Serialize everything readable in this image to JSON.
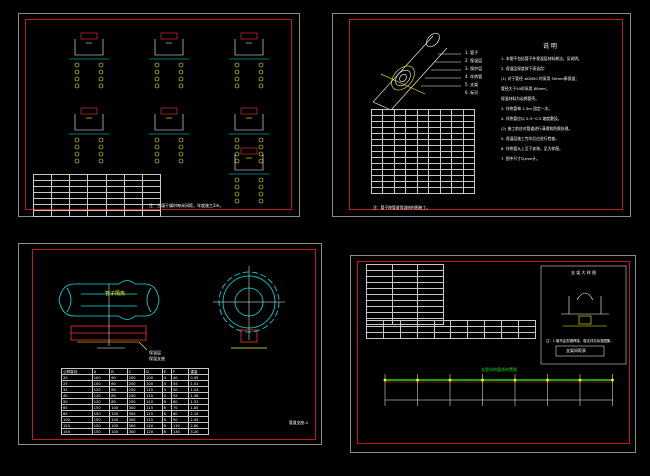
{
  "sheet1": {
    "footnote": "注：土壤干燥时每米间距，年度施工2m。",
    "table_rows": 7
  },
  "sheet2": {
    "legend_items": [
      "1. 管子",
      "2. 保温层",
      "3. 保护层",
      "4. 伴热管",
      "5. 支架",
      "6. 标识"
    ],
    "notes_title": "说 明",
    "notes": [
      "1. 本图不包括管子外保温层材料做法，见说明。",
      "2. 保温层厚度按下表选用：",
      "(1) 对于管径 ≤DN50 时采用 50mm厚保温；",
      "   管径大于50时采用 80mm；",
      "   保温材料为岩棉管壳。",
      "3. 伴热管每 1.5m 固定一次。",
      "4. 伴热管应以 0.3~0.5 坡度敷设。",
      "(2) 施工前应对管道进行清理和防腐处理。",
      "5. 保温层施工完毕后应进行检查。",
      "6. 伴热管从上至下安装，见大样图。",
      "7. 图中尺寸以mm计。"
    ],
    "table_rows": 14,
    "footnote": "注：管子按管道保温结构图施工。"
  },
  "sheet3": {
    "label_a": "管子隔热",
    "label_b": "保温层",
    "label_c": "保温支座",
    "table_rows": [
      [
        "公称直径",
        "A",
        "B",
        "C",
        "D",
        "E",
        "F",
        "重量"
      ],
      [
        "20",
        "100",
        "60",
        "200",
        "100",
        "4",
        "40",
        "0.95"
      ],
      [
        "25",
        "100",
        "60",
        "200",
        "100",
        "4",
        "45",
        "1.01"
      ],
      [
        "32",
        "120",
        "80",
        "250",
        "110",
        "4",
        "50",
        "1.24"
      ],
      [
        "40",
        "120",
        "80",
        "250",
        "110",
        "4",
        "55",
        "1.36"
      ],
      [
        "50",
        "120",
        "80",
        "250",
        "110",
        "6",
        "60",
        "1.52"
      ],
      [
        "65",
        "150",
        "100",
        "300",
        "115",
        "6",
        "70",
        "1.85"
      ],
      [
        "80",
        "150",
        "100",
        "300",
        "115",
        "6",
        "80",
        "2.10"
      ],
      [
        "100",
        "150",
        "100",
        "300",
        "115",
        "6",
        "90",
        "2.45"
      ],
      [
        "125",
        "150",
        "100",
        "300",
        "120",
        "6",
        "110",
        "2.80"
      ],
      [
        "150",
        "150",
        "100",
        "300",
        "120",
        "6",
        "130",
        "3.20"
      ]
    ],
    "footnote": "管道支座-4"
  },
  "sheet4": {
    "detail_title": "支 架 大 样 图",
    "detail_note": "注：1.管托由型钢焊接，做法详见标准图集。",
    "detail_caption": "支架间距表",
    "elev_title": "支管伴热管线布置图",
    "table_rows": 10
  }
}
